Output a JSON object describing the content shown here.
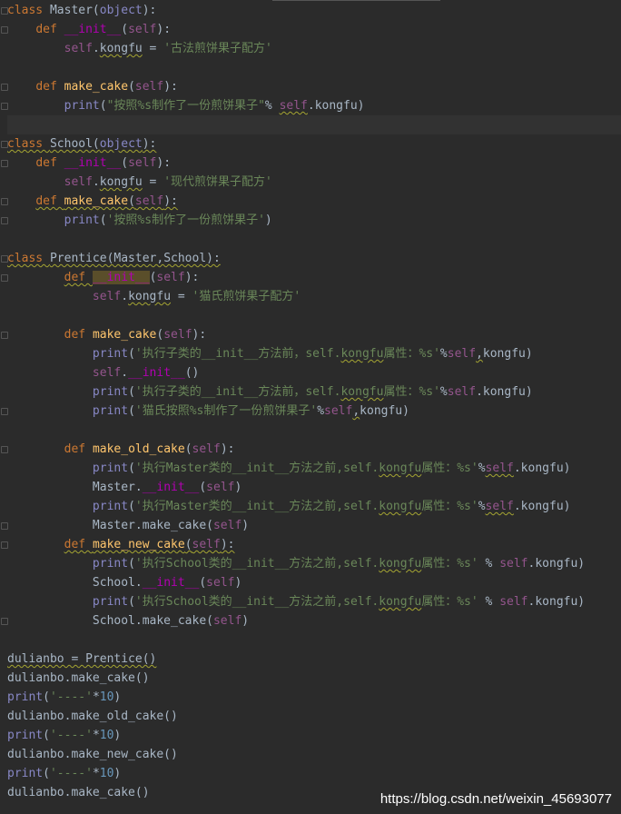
{
  "watermark": "https://blog.csdn.net/weixin_45693077",
  "lines": [
    [
      [
        "kw",
        "class "
      ],
      [
        "plain",
        "Master("
      ],
      [
        "builtin",
        "object"
      ],
      [
        "plain",
        "):"
      ]
    ],
    [
      [
        "plain",
        "    "
      ],
      [
        "kw",
        "def "
      ],
      [
        "magic",
        "__init__"
      ],
      [
        "plain",
        "("
      ],
      [
        "self",
        "self"
      ],
      [
        "plain",
        "):"
      ]
    ],
    [
      [
        "plain",
        "        "
      ],
      [
        "self",
        "self"
      ],
      [
        "plain",
        "."
      ],
      [
        "warnp",
        "kongfu"
      ],
      [
        "plain",
        " = "
      ],
      [
        "str",
        "'古法煎饼果子配方'"
      ]
    ],
    [],
    [
      [
        "plain",
        "    "
      ],
      [
        "kw",
        "def "
      ],
      [
        "fn",
        "make_cake"
      ],
      [
        "plain",
        "("
      ],
      [
        "self",
        "self"
      ],
      [
        "plain",
        "):"
      ]
    ],
    [
      [
        "plain",
        "        "
      ],
      [
        "builtin",
        "print"
      ],
      [
        "plain",
        "("
      ],
      [
        "str",
        "\"按照%s制作了一份煎饼果子\""
      ],
      [
        "plain",
        "% "
      ],
      [
        "warnself",
        "self"
      ],
      [
        "plain",
        ".kongfu)"
      ]
    ],
    [],
    [
      [
        "warnkw",
        "class "
      ],
      [
        "warnp",
        "School("
      ],
      [
        "warnbuiltin",
        "object"
      ],
      [
        "warnp",
        "):"
      ]
    ],
    [
      [
        "plain",
        "    "
      ],
      [
        "kw",
        "def "
      ],
      [
        "magic",
        "__init__"
      ],
      [
        "plain",
        "("
      ],
      [
        "self",
        "self"
      ],
      [
        "plain",
        "):"
      ]
    ],
    [
      [
        "plain",
        "        "
      ],
      [
        "self",
        "self"
      ],
      [
        "plain",
        "."
      ],
      [
        "warnp",
        "kongfu"
      ],
      [
        "plain",
        " = "
      ],
      [
        "str",
        "'现代煎饼果子配方'"
      ]
    ],
    [
      [
        "plain",
        "    "
      ],
      [
        "warnkw",
        "def "
      ],
      [
        "warnfn",
        "make_cake"
      ],
      [
        "warnp",
        "("
      ],
      [
        "warnself",
        "self"
      ],
      [
        "warnp",
        "):"
      ]
    ],
    [
      [
        "plain",
        "        "
      ],
      [
        "builtin",
        "print"
      ],
      [
        "plain",
        "("
      ],
      [
        "str",
        "'按照%s制作了一份煎饼果子'"
      ],
      [
        "plain",
        ")"
      ]
    ],
    [],
    [
      [
        "warnkw",
        "class "
      ],
      [
        "warnp",
        "Prentice(Master,School):"
      ]
    ],
    [
      [
        "plain",
        "        "
      ],
      [
        "warnkw",
        "def "
      ],
      [
        "hlmagic",
        "__init__"
      ],
      [
        "plain",
        "("
      ],
      [
        "self",
        "self"
      ],
      [
        "plain",
        "):"
      ]
    ],
    [
      [
        "plain",
        "            "
      ],
      [
        "self",
        "self"
      ],
      [
        "plain",
        "."
      ],
      [
        "warnp",
        "kongfu"
      ],
      [
        "plain",
        " = "
      ],
      [
        "str",
        "'猫氏煎饼果子配方'"
      ]
    ],
    [],
    [
      [
        "plain",
        "        "
      ],
      [
        "kw",
        "def "
      ],
      [
        "fn",
        "make_cake"
      ],
      [
        "plain",
        "("
      ],
      [
        "self",
        "self"
      ],
      [
        "plain",
        "):"
      ]
    ],
    [
      [
        "plain",
        "            "
      ],
      [
        "builtin",
        "print"
      ],
      [
        "plain",
        "("
      ],
      [
        "str",
        "'执行子类的__init__方法前，self."
      ],
      [
        "warnstr",
        "kongfu"
      ],
      [
        "str",
        "属性：%s'"
      ],
      [
        "plain",
        "%"
      ],
      [
        "self",
        "self"
      ],
      [
        "warnp",
        ","
      ],
      [
        "plain",
        "kongfu)"
      ]
    ],
    [
      [
        "plain",
        "            "
      ],
      [
        "self",
        "self"
      ],
      [
        "plain",
        "."
      ],
      [
        "magic",
        "__init__"
      ],
      [
        "plain",
        "()"
      ]
    ],
    [
      [
        "plain",
        "            "
      ],
      [
        "builtin",
        "print"
      ],
      [
        "plain",
        "("
      ],
      [
        "str",
        "'执行子类的__init__方法前，self."
      ],
      [
        "warnstr",
        "kongfu"
      ],
      [
        "str",
        "属性：%s'"
      ],
      [
        "plain",
        "%"
      ],
      [
        "self",
        "self"
      ],
      [
        "plain",
        ".kongfu)"
      ]
    ],
    [
      [
        "plain",
        "            "
      ],
      [
        "builtin",
        "print"
      ],
      [
        "plain",
        "("
      ],
      [
        "str",
        "'猫氏按照%s制作了一份煎饼果子'"
      ],
      [
        "plain",
        "%"
      ],
      [
        "self",
        "self"
      ],
      [
        "warnp",
        ","
      ],
      [
        "plain",
        "kongfu)"
      ]
    ],
    [],
    [
      [
        "plain",
        "        "
      ],
      [
        "kw",
        "def "
      ],
      [
        "fn",
        "make_old_cake"
      ],
      [
        "plain",
        "("
      ],
      [
        "self",
        "self"
      ],
      [
        "plain",
        "):"
      ]
    ],
    [
      [
        "plain",
        "            "
      ],
      [
        "builtin",
        "print"
      ],
      [
        "plain",
        "("
      ],
      [
        "str",
        "'执行Master类的__init__方法之前,self."
      ],
      [
        "warnstr",
        "kongfu"
      ],
      [
        "str",
        "属性：%s'"
      ],
      [
        "plain",
        "%"
      ],
      [
        "warnself",
        "self"
      ],
      [
        "plain",
        ".kongfu)"
      ]
    ],
    [
      [
        "plain",
        "            Master."
      ],
      [
        "magic",
        "__init__"
      ],
      [
        "plain",
        "("
      ],
      [
        "self",
        "self"
      ],
      [
        "plain",
        ")"
      ]
    ],
    [
      [
        "plain",
        "            "
      ],
      [
        "builtin",
        "print"
      ],
      [
        "plain",
        "("
      ],
      [
        "str",
        "'执行Master类的__init__方法之前,self."
      ],
      [
        "warnstr",
        "kongfu"
      ],
      [
        "str",
        "属性：%s'"
      ],
      [
        "plain",
        "%"
      ],
      [
        "warnself",
        "self"
      ],
      [
        "plain",
        ".kongfu)"
      ]
    ],
    [
      [
        "plain",
        "            Master.make_cake("
      ],
      [
        "self",
        "self"
      ],
      [
        "plain",
        ")"
      ]
    ],
    [
      [
        "plain",
        "        "
      ],
      [
        "warnkw",
        "def "
      ],
      [
        "warnfn",
        "make_new_cake"
      ],
      [
        "warnp",
        "("
      ],
      [
        "warnself",
        "self"
      ],
      [
        "warnp",
        "):"
      ]
    ],
    [
      [
        "plain",
        "            "
      ],
      [
        "builtin",
        "print"
      ],
      [
        "plain",
        "("
      ],
      [
        "str",
        "'执行School类的__init__方法之前,self."
      ],
      [
        "warnstr",
        "kongfu"
      ],
      [
        "str",
        "属性：%s'"
      ],
      [
        "plain",
        " % "
      ],
      [
        "self",
        "self"
      ],
      [
        "plain",
        ".kongfu)"
      ]
    ],
    [
      [
        "plain",
        "            School."
      ],
      [
        "magic",
        "__init__"
      ],
      [
        "plain",
        "("
      ],
      [
        "self",
        "self"
      ],
      [
        "plain",
        ")"
      ]
    ],
    [
      [
        "plain",
        "            "
      ],
      [
        "builtin",
        "print"
      ],
      [
        "plain",
        "("
      ],
      [
        "str",
        "'执行School类的__init__方法之前,self."
      ],
      [
        "warnstr",
        "kongfu"
      ],
      [
        "str",
        "属性：%s'"
      ],
      [
        "plain",
        " % "
      ],
      [
        "self",
        "self"
      ],
      [
        "plain",
        ".kongfu)"
      ]
    ],
    [
      [
        "plain",
        "            School.make_cake("
      ],
      [
        "self",
        "self"
      ],
      [
        "plain",
        ")"
      ]
    ],
    [],
    [
      [
        "warnp",
        "dulianbo = Prentice()"
      ]
    ],
    [
      [
        "plain",
        "dulianbo.make_cake()"
      ]
    ],
    [
      [
        "builtin",
        "print"
      ],
      [
        "plain",
        "("
      ],
      [
        "str",
        "'----'"
      ],
      [
        "plain",
        "*"
      ],
      [
        "num",
        "10"
      ],
      [
        "plain",
        ")"
      ]
    ],
    [
      [
        "plain",
        "dulianbo.make_old_cake()"
      ]
    ],
    [
      [
        "builtin",
        "print"
      ],
      [
        "plain",
        "("
      ],
      [
        "str",
        "'----'"
      ],
      [
        "plain",
        "*"
      ],
      [
        "num",
        "10"
      ],
      [
        "plain",
        ")"
      ]
    ],
    [
      [
        "plain",
        "dulianbo.make_new_cake()"
      ]
    ],
    [
      [
        "builtin",
        "print"
      ],
      [
        "plain",
        "("
      ],
      [
        "str",
        "'----'"
      ],
      [
        "plain",
        "*"
      ],
      [
        "num",
        "10"
      ],
      [
        "plain",
        ")"
      ]
    ],
    [
      [
        "plain",
        "dulianbo.make_cake()"
      ]
    ]
  ]
}
